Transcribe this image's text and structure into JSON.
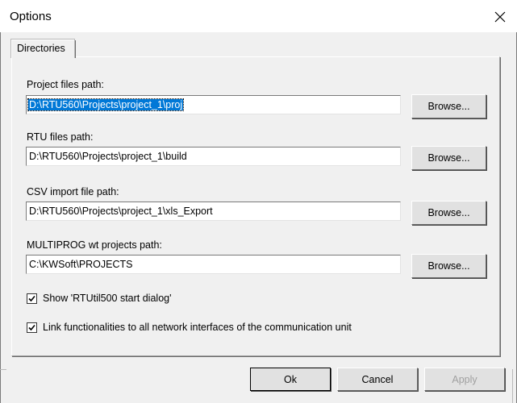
{
  "window": {
    "title": "Options"
  },
  "tabs": [
    {
      "label": "Directories"
    }
  ],
  "fields": [
    {
      "label": "Project files path:",
      "value": "D:\\RTU560\\Projects\\project_1\\proj",
      "button": "Browse..."
    },
    {
      "label": "RTU files path:",
      "value": "D:\\RTU560\\Projects\\project_1\\build",
      "button": "Browse..."
    },
    {
      "label": "CSV import file path:",
      "value": "D:\\RTU560\\Projects\\project_1\\xls_Export",
      "button": "Browse..."
    },
    {
      "label": "MULTIPROG wt projects path:",
      "value": "C:\\KWSoft\\PROJECTS",
      "button": "Browse..."
    }
  ],
  "checkboxes": [
    {
      "label": "Show 'RTUtil500 start dialog'",
      "checked": true
    },
    {
      "label": "Link functionalities to all network interfaces of the communication unit",
      "checked": true
    }
  ],
  "footer": {
    "ok": "Ok",
    "cancel": "Cancel",
    "apply": "Apply"
  }
}
